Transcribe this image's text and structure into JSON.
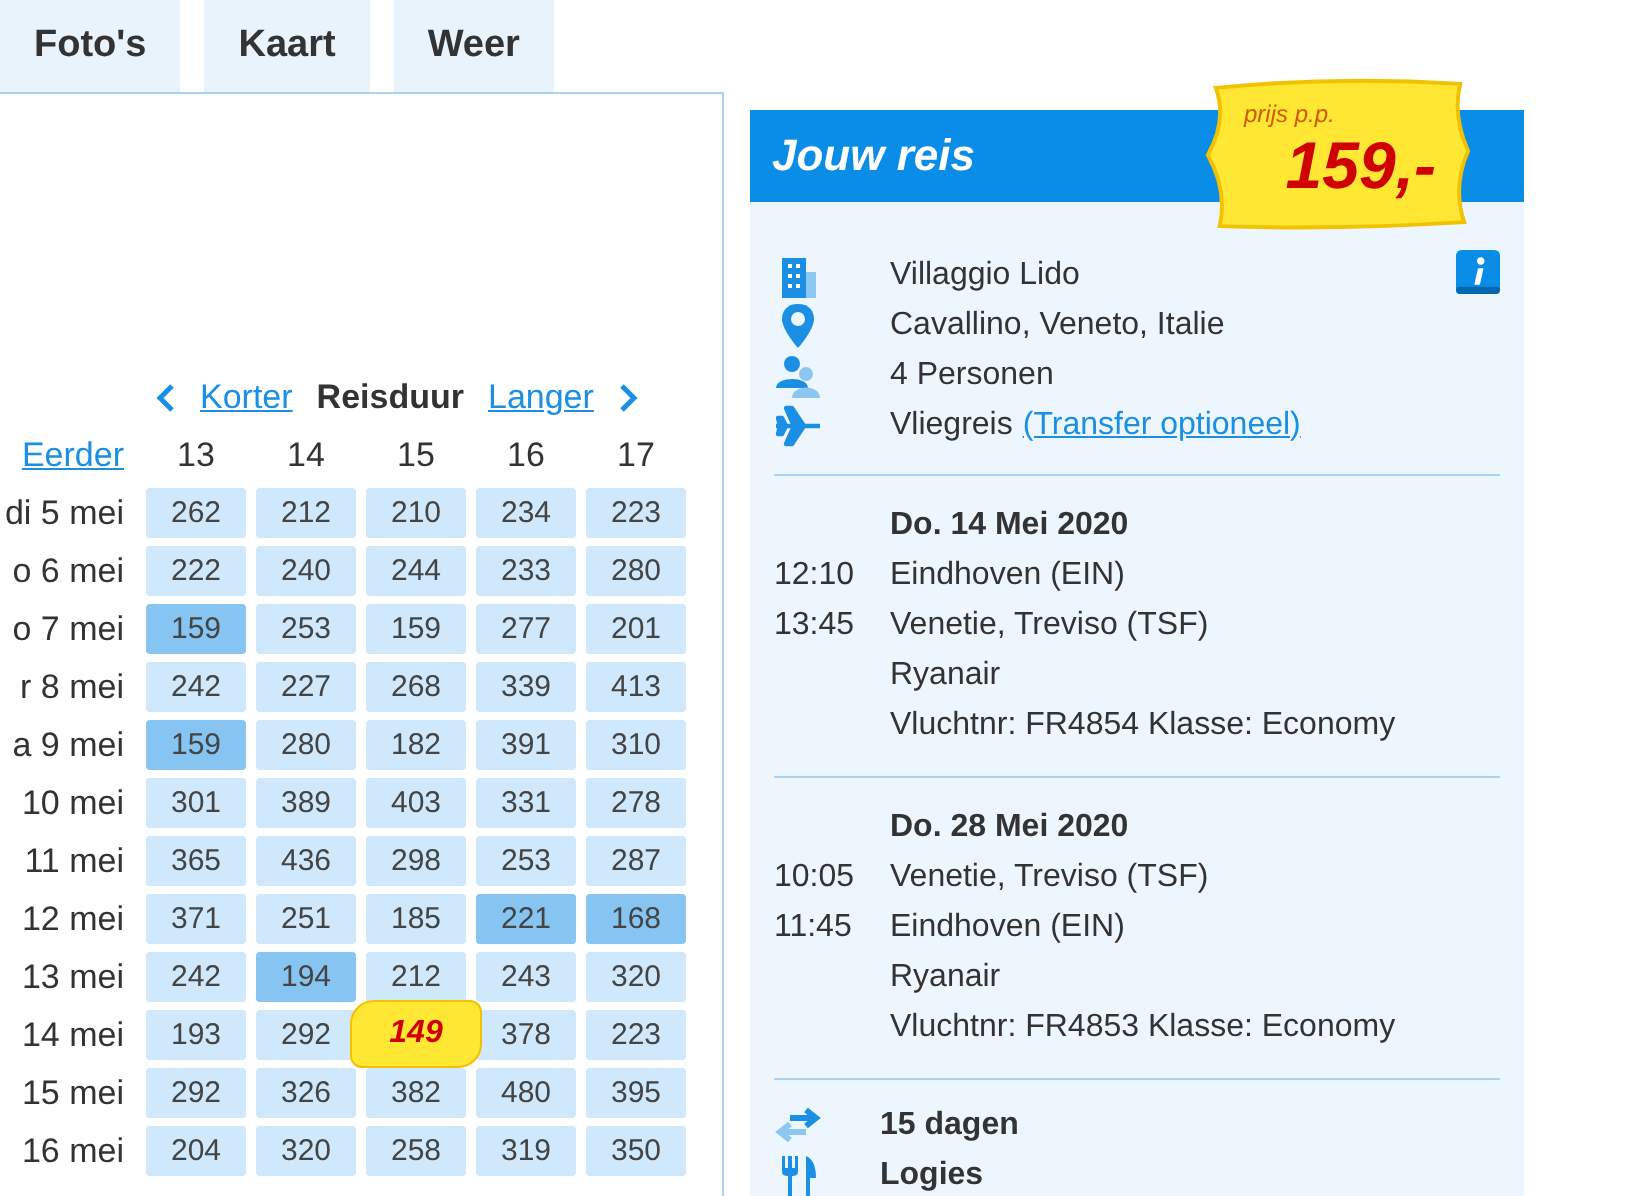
{
  "tabs": [
    {
      "label": "Foto's",
      "selected": false
    },
    {
      "label": "Kaart",
      "selected": false
    },
    {
      "label": "Weer",
      "selected": false
    }
  ],
  "calendar": {
    "shorter": "Korter",
    "title": "Reisduur",
    "longer": "Langer",
    "earlier": "Eerder",
    "columns": [
      "13",
      "14",
      "15",
      "16",
      "17"
    ],
    "rows": [
      {
        "label": "di 5 mei",
        "cells": [
          {
            "value": "262",
            "kind": "normal"
          },
          {
            "value": "212",
            "kind": "normal"
          },
          {
            "value": "210",
            "kind": "normal"
          },
          {
            "value": "234",
            "kind": "normal"
          },
          {
            "value": "223",
            "kind": "normal"
          }
        ]
      },
      {
        "label": "o 6 mei",
        "cells": [
          {
            "value": "222",
            "kind": "normal"
          },
          {
            "value": "240",
            "kind": "normal"
          },
          {
            "value": "244",
            "kind": "normal"
          },
          {
            "value": "233",
            "kind": "normal"
          },
          {
            "value": "280",
            "kind": "normal"
          }
        ]
      },
      {
        "label": "o 7 mei",
        "cells": [
          {
            "value": "159",
            "kind": "low"
          },
          {
            "value": "253",
            "kind": "normal"
          },
          {
            "value": "159",
            "kind": "normal"
          },
          {
            "value": "277",
            "kind": "normal"
          },
          {
            "value": "201",
            "kind": "normal"
          }
        ]
      },
      {
        "label": "r 8 mei",
        "cells": [
          {
            "value": "242",
            "kind": "normal"
          },
          {
            "value": "227",
            "kind": "normal"
          },
          {
            "value": "268",
            "kind": "normal"
          },
          {
            "value": "339",
            "kind": "normal"
          },
          {
            "value": "413",
            "kind": "normal"
          }
        ]
      },
      {
        "label": "a 9 mei",
        "cells": [
          {
            "value": "159",
            "kind": "low"
          },
          {
            "value": "280",
            "kind": "normal"
          },
          {
            "value": "182",
            "kind": "normal"
          },
          {
            "value": "391",
            "kind": "normal"
          },
          {
            "value": "310",
            "kind": "normal"
          }
        ]
      },
      {
        "label": "10 mei",
        "cells": [
          {
            "value": "301",
            "kind": "normal"
          },
          {
            "value": "389",
            "kind": "normal"
          },
          {
            "value": "403",
            "kind": "normal"
          },
          {
            "value": "331",
            "kind": "normal"
          },
          {
            "value": "278",
            "kind": "normal"
          }
        ]
      },
      {
        "label": "11 mei",
        "cells": [
          {
            "value": "365",
            "kind": "normal"
          },
          {
            "value": "436",
            "kind": "normal"
          },
          {
            "value": "298",
            "kind": "normal"
          },
          {
            "value": "253",
            "kind": "normal"
          },
          {
            "value": "287",
            "kind": "normal"
          }
        ]
      },
      {
        "label": "12 mei",
        "cells": [
          {
            "value": "371",
            "kind": "normal"
          },
          {
            "value": "251",
            "kind": "normal"
          },
          {
            "value": "185",
            "kind": "normal"
          },
          {
            "value": "221",
            "kind": "low"
          },
          {
            "value": "168",
            "kind": "low"
          }
        ]
      },
      {
        "label": "13 mei",
        "cells": [
          {
            "value": "242",
            "kind": "normal"
          },
          {
            "value": "194",
            "kind": "low"
          },
          {
            "value": "212",
            "kind": "normal"
          },
          {
            "value": "243",
            "kind": "normal"
          },
          {
            "value": "320",
            "kind": "normal"
          }
        ]
      },
      {
        "label": "14 mei",
        "cells": [
          {
            "value": "193",
            "kind": "normal"
          },
          {
            "value": "292",
            "kind": "normal"
          },
          {
            "value": "149",
            "kind": "selected"
          },
          {
            "value": "378",
            "kind": "normal"
          },
          {
            "value": "223",
            "kind": "normal"
          }
        ]
      },
      {
        "label": "15 mei",
        "cells": [
          {
            "value": "292",
            "kind": "normal"
          },
          {
            "value": "326",
            "kind": "normal"
          },
          {
            "value": "382",
            "kind": "normal"
          },
          {
            "value": "480",
            "kind": "normal"
          },
          {
            "value": "395",
            "kind": "normal"
          }
        ]
      },
      {
        "label": "16 mei",
        "cells": [
          {
            "value": "204",
            "kind": "normal"
          },
          {
            "value": "320",
            "kind": "normal"
          },
          {
            "value": "258",
            "kind": "normal"
          },
          {
            "value": "319",
            "kind": "normal"
          },
          {
            "value": "350",
            "kind": "normal"
          }
        ]
      }
    ]
  },
  "trip": {
    "title": "Jouw reis",
    "price_label": "prijs p.p.",
    "price": "159,-",
    "details": [
      {
        "kind": "hotel",
        "text": "Villaggio Lido"
      },
      {
        "kind": "location",
        "text": "Cavallino, Veneto, Italie"
      },
      {
        "kind": "persons",
        "text": "4 Personen"
      },
      {
        "kind": "flight",
        "text": "Vliegreis",
        "link": "(Transfer optioneel)"
      }
    ],
    "flights": [
      {
        "date": "Do. 14 Mei 2020",
        "legs": [
          {
            "time": "12:10",
            "place": "Eindhoven (EIN)"
          },
          {
            "time": "13:45",
            "place": "Venetie, Treviso (TSF)"
          }
        ],
        "airline": "Ryanair",
        "info": "Vluchtnr: FR4854 Klasse: Economy"
      },
      {
        "date": "Do. 28 Mei 2020",
        "legs": [
          {
            "time": "10:05",
            "place": "Venetie, Treviso (TSF)"
          },
          {
            "time": "11:45",
            "place": "Eindhoven (EIN)"
          }
        ],
        "airline": "Ryanair",
        "info": "Vluchtnr: FR4853 Klasse: Economy"
      }
    ],
    "summary": [
      {
        "kind": "duration",
        "text": "15 dagen"
      },
      {
        "kind": "board",
        "text": "Logies"
      }
    ]
  }
}
